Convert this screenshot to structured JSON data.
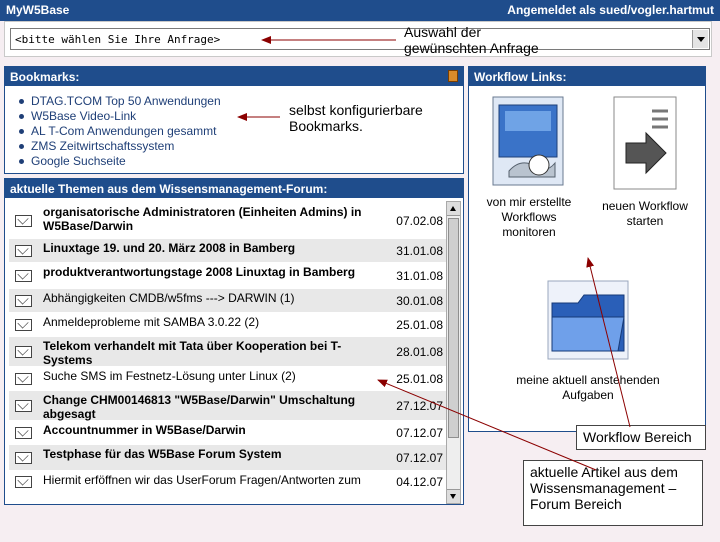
{
  "topbar": {
    "title": "MyW5Base",
    "login": "Angemeldet als sued/vogler.hartmut"
  },
  "query": {
    "selected": "<bitte wählen Sie Ihre Anfrage>"
  },
  "bookmarks": {
    "header": "Bookmarks:",
    "items": [
      "DTAG.TCOM Top 50 Anwendungen",
      "W5Base Video-Link",
      "AL T-Com Anwendungen gesammt",
      "ZMS Zeitwirtschaftssystem",
      "Google Suchseite"
    ]
  },
  "forum": {
    "header": "aktuelle Themen aus dem Wissensmanagement-Forum:",
    "rows": [
      {
        "subject": "organisatorische Administratoren (Einheiten Admins) in W5Base/Darwin",
        "date": "07.02.08",
        "bold": true
      },
      {
        "subject": "Linuxtage 19. und 20. März 2008 in Bamberg",
        "date": "31.01.08",
        "bold": true
      },
      {
        "subject": "produktverantwortungstage 2008 Linuxtag in Bamberg",
        "date": "31.01.08",
        "bold": true
      },
      {
        "subject": "Abhängigkeiten CMDB/w5fms ---> DARWIN (1)",
        "date": "30.01.08",
        "bold": false
      },
      {
        "subject": "Anmeldeprobleme mit SAMBA 3.0.22 (2)",
        "date": "25.01.08",
        "bold": false
      },
      {
        "subject": "Telekom verhandelt mit Tata über Kooperation bei T-Systems",
        "date": "28.01.08",
        "bold": true
      },
      {
        "subject": "Suche SMS im Festnetz-Lösung unter Linux (2)",
        "date": "25.01.08",
        "bold": false
      },
      {
        "subject": "Change CHM00146813 \"W5Base/Darwin\" Umschaltung abgesagt",
        "date": "27.12.07",
        "bold": true
      },
      {
        "subject": "Accountnummer in W5Base/Darwin",
        "date": "07.12.07",
        "bold": true
      },
      {
        "subject": "Testphase für das W5Base Forum System",
        "date": "07.12.07",
        "bold": true
      },
      {
        "subject": "Hiermit erföffnen wir das UserForum Fragen/Antworten zum",
        "date": "04.12.07",
        "bold": false
      }
    ]
  },
  "workflow": {
    "header": "Workflow Links:",
    "monitor_label": "von mir erstellte Workflows monitoren",
    "start_label": "neuen Workflow starten",
    "tasks_label": "meine aktuell anstehenden Aufgaben"
  },
  "callouts": {
    "query": "Auswahl der gewünschten Anfrage",
    "bookmarks": "selbst konfigurierbare Bookmarks.",
    "workflow": "Workflow Bereich",
    "forum": "aktuelle Artikel aus dem Wissensmanagement – Forum Bereich"
  },
  "colors": {
    "header_blue": "#1f4d8c",
    "background": "#f6eef2",
    "link_blue": "#1f3f77"
  }
}
